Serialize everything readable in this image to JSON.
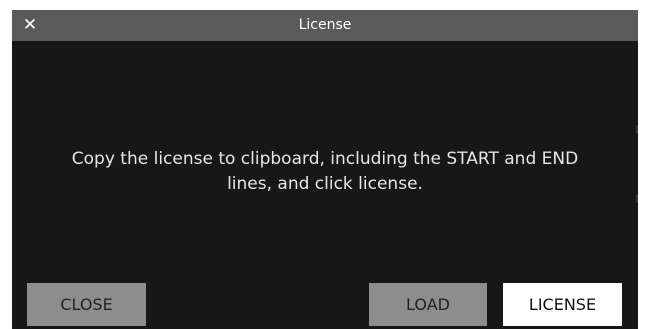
{
  "dialog": {
    "title": "License",
    "close_icon": "close-icon",
    "close_glyph": "✕",
    "message_line1": "Copy the license to clipboard, including the START and END",
    "message_line2": "lines, and click license."
  },
  "buttons": {
    "close_label": "CLOSE",
    "load_label": "LOAD",
    "license_label": "LICENSE"
  },
  "colors": {
    "titlebar": "#5a5a5a",
    "dialog_bg": "#171717",
    "secondary_button": "#8d8d8d",
    "primary_button": "#ffffff"
  }
}
